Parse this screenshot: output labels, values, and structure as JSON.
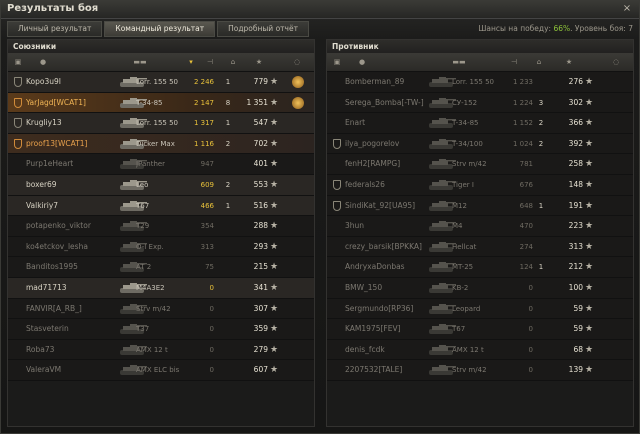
{
  "window": {
    "title": "Результаты боя",
    "close": "×"
  },
  "tabs": [
    {
      "label": "Личный результат"
    },
    {
      "label": "Командный результат"
    },
    {
      "label": "Подробный отчёт"
    }
  ],
  "stats": {
    "win_label": "Шансы на победу:",
    "win_value": "66%",
    "level_label": "Уровень боя: 7"
  },
  "colors": {
    "accent": "#8fc43a",
    "gold": "#e9c23a",
    "player": "#f0b455"
  },
  "allies": {
    "title": "Союзники",
    "rows": [
      {
        "name": "Kopo3u9I",
        "tank": "Lorr. 155 50",
        "dmg": "2 246",
        "kills": "1",
        "xp": "779",
        "status": "alive",
        "platoon": "white",
        "medal": true
      },
      {
        "name": "YarJagd[WCAT1]",
        "tank": "T-34-85",
        "dmg": "2 147",
        "kills": "8",
        "xp": "1 351",
        "status": "player",
        "platoon": "gold",
        "medal": true
      },
      {
        "name": "Krugliy13",
        "tank": "Lorr. 155 50",
        "dmg": "1 317",
        "kills": "1",
        "xp": "547",
        "status": "alive",
        "platoon": "white",
        "medal": false
      },
      {
        "name": "proof13[WCAT1]",
        "tank": "Dicker Max",
        "dmg": "1 116",
        "kills": "2",
        "xp": "702",
        "status": "platoonh",
        "platoon": "gold",
        "medal": false
      },
      {
        "name": "Purp1eHeart",
        "tank": "JPanther",
        "dmg": "947",
        "kills": "",
        "xp": "401",
        "status": "dead",
        "platoon": "",
        "medal": false
      },
      {
        "name": "boxer69",
        "tank": "Leo",
        "dmg": "609",
        "kills": "2",
        "xp": "553",
        "status": "alive",
        "platoon": "",
        "medal": false
      },
      {
        "name": "Valkiriy7",
        "tank": "T67",
        "dmg": "466",
        "kills": "1",
        "xp": "516",
        "status": "alive",
        "platoon": "",
        "medal": false
      },
      {
        "name": "potapenko_viktor",
        "tank": "T29",
        "dmg": "354",
        "kills": "",
        "xp": "288",
        "status": "dead",
        "platoon": "",
        "medal": false
      },
      {
        "name": "ko4etckov_lesha",
        "tank": "O-I Exp.",
        "dmg": "313",
        "kills": "",
        "xp": "293",
        "status": "dead",
        "platoon": "",
        "medal": false
      },
      {
        "name": "Banditos1995",
        "tank": "AT 2",
        "dmg": "75",
        "kills": "",
        "xp": "215",
        "status": "dead",
        "platoon": "",
        "medal": false
      },
      {
        "name": "mad71713",
        "tank": "M4A3E2",
        "dmg": "0",
        "kills": "",
        "xp": "341",
        "status": "alive",
        "platoon": "",
        "medal": false
      },
      {
        "name": "FANVIR[A_RB_]",
        "tank": "Strv m/42",
        "dmg": "0",
        "kills": "",
        "xp": "307",
        "status": "dead",
        "platoon": "",
        "medal": false
      },
      {
        "name": "Stasveterin",
        "tank": "T37",
        "dmg": "0",
        "kills": "",
        "xp": "359",
        "status": "dead",
        "platoon": "",
        "medal": false
      },
      {
        "name": "Roba73",
        "tank": "AMX 12 t",
        "dmg": "0",
        "kills": "",
        "xp": "279",
        "status": "dead",
        "platoon": "",
        "medal": false
      },
      {
        "name": "ValeraVM",
        "tank": "AMX ELC bis",
        "dmg": "0",
        "kills": "",
        "xp": "607",
        "status": "dead",
        "platoon": "",
        "medal": false
      }
    ]
  },
  "enemies": {
    "title": "Противник",
    "rows": [
      {
        "name": "Bomberman_89",
        "tank": "Lorr. 155 50",
        "dmg": "1 233",
        "kills": "",
        "xp": "276",
        "status": "dead",
        "platoon": ""
      },
      {
        "name": "Serega_Bomba[-TW-]",
        "tank": "СУ-152",
        "dmg": "1 224",
        "kills": "3",
        "xp": "302",
        "status": "dead",
        "platoon": ""
      },
      {
        "name": "Enart",
        "tank": "T-34-85",
        "dmg": "1 152",
        "kills": "2",
        "xp": "366",
        "status": "dead",
        "platoon": ""
      },
      {
        "name": "ilya_pogorelov",
        "tank": "T-34/100",
        "dmg": "1 024",
        "kills": "2",
        "xp": "392",
        "status": "dead",
        "platoon": "white"
      },
      {
        "name": "fenH2[RAMPG]",
        "tank": "Strv m/42",
        "dmg": "781",
        "kills": "",
        "xp": "258",
        "status": "dead",
        "platoon": ""
      },
      {
        "name": "federals26",
        "tank": "Tiger I",
        "dmg": "676",
        "kills": "",
        "xp": "148",
        "status": "dead",
        "platoon": "white"
      },
      {
        "name": "SindiKat_92[UA95]",
        "tank": "M12",
        "dmg": "648",
        "kills": "1",
        "xp": "191",
        "status": "dead",
        "platoon": "white"
      },
      {
        "name": "3hun",
        "tank": "M4",
        "dmg": "470",
        "kills": "",
        "xp": "223",
        "status": "dead",
        "platoon": ""
      },
      {
        "name": "crezy_barsik[BPKKA]",
        "tank": "Hellcat",
        "dmg": "274",
        "kills": "",
        "xp": "313",
        "status": "dead",
        "platoon": ""
      },
      {
        "name": "AndryxaDonbas",
        "tank": "MT-25",
        "dmg": "124",
        "kills": "1",
        "xp": "212",
        "status": "dead",
        "platoon": ""
      },
      {
        "name": "BMW_150",
        "tank": "KB-2",
        "dmg": "0",
        "kills": "",
        "xp": "100",
        "status": "dead",
        "platoon": ""
      },
      {
        "name": "Sergmundo[RP36]",
        "tank": "Leopard",
        "dmg": "0",
        "kills": "",
        "xp": "59",
        "status": "dead",
        "platoon": ""
      },
      {
        "name": "KAM1975[FEV]",
        "tank": "T67",
        "dmg": "0",
        "kills": "",
        "xp": "59",
        "status": "dead",
        "platoon": ""
      },
      {
        "name": "denis_fcdk",
        "tank": "AMX 12 t",
        "dmg": "0",
        "kills": "",
        "xp": "68",
        "status": "dead",
        "platoon": ""
      },
      {
        "name": "2207532[TALE]",
        "tank": "Strv m/42",
        "dmg": "0",
        "kills": "",
        "xp": "139",
        "status": "dead",
        "platoon": ""
      }
    ]
  }
}
